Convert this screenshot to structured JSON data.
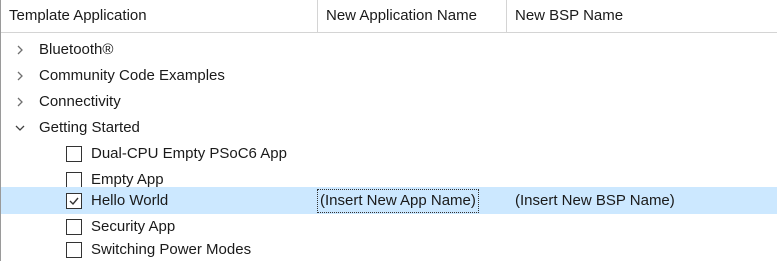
{
  "columns": [
    "Template Application",
    "New Application Name",
    "New BSP Name"
  ],
  "categories": [
    {
      "label": "Bluetooth®",
      "expanded": false
    },
    {
      "label": "Community Code Examples",
      "expanded": false
    },
    {
      "label": "Connectivity",
      "expanded": false
    },
    {
      "label": "Getting Started",
      "expanded": true
    }
  ],
  "apps": [
    {
      "label": "Dual-CPU Empty PSoC6 App",
      "checked": false
    },
    {
      "label": "Empty App",
      "checked": false
    },
    {
      "label": "Hello World",
      "checked": true,
      "new_app_name": "(Insert New App Name)",
      "new_bsp_name": "(Insert New BSP Name)"
    },
    {
      "label": "Security App",
      "checked": false
    },
    {
      "label": "Switching Power Modes",
      "checked": false
    }
  ],
  "colors": {
    "selection": "#cce8ff",
    "grid_line": "#d4d4d4",
    "text": "#1a1a1a"
  },
  "icons": {
    "collapsed": "chevron-right-icon",
    "expanded": "chevron-down-icon",
    "checked": "checkbox-checked-icon",
    "unchecked": "checkbox-unchecked-icon"
  }
}
